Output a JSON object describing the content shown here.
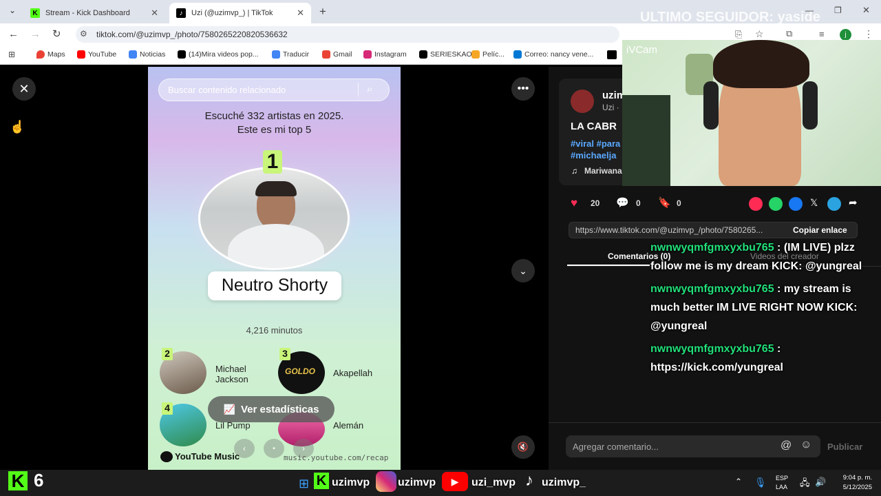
{
  "tabs": [
    {
      "title": "Stream - Kick Dashboard"
    },
    {
      "title": "Uzi (@uzimvp_) | TikTok"
    }
  ],
  "overlay_follower": "ULTIMO SEGUIDOR: yaside",
  "address": {
    "url": "tiktok.com/@uzimvp_/photo/7580265220820536632"
  },
  "bookmarks": [
    "Maps",
    "YouTube",
    "Noticias",
    "(14)Mira videos pop...",
    "Traducir",
    "Gmail",
    "Instagram",
    "SERIESKAO",
    "Pelíc...",
    "Correo: nancy vene..."
  ],
  "photo": {
    "search_placeholder": "Buscar contenido relacionado",
    "headline1": "Escuché 332 artistas en 2025.",
    "headline2": "Este es mi top 5",
    "rank1": "1",
    "top_artist": "Neutro Shorty",
    "minutes": "4,216 minutos",
    "artists": [
      {
        "rank": "2",
        "name1": "Michael",
        "name2": "Jackson"
      },
      {
        "rank": "3",
        "name1": "Akapellah",
        "name2": ""
      },
      {
        "rank": "4",
        "name1": "Lil Pump",
        "name2": ""
      },
      {
        "rank": "",
        "name1": "Alemán",
        "name2": ""
      }
    ],
    "stats_button": "Ver estadísticas",
    "footer_brand": "YouTube Music",
    "footer_url": "music.youtube.com/recap"
  },
  "post": {
    "author_handle": "uzim",
    "author_sub": "Uzi ·",
    "caption": "LA CABR",
    "tags1": "#viral #para",
    "tags2": "#michaelja",
    "music": "Mariwana",
    "likes": "20",
    "comments": "0",
    "saves": "0",
    "link_url": "https://www.tiktok.com/@uzimvp_/photo/7580265...",
    "copy_link": "Copiar enlace",
    "tab_comments": "Comentarios (0)",
    "tab_creator": "Videos del creador",
    "comment_placeholder": "Agregar comentario...",
    "publish": "Publicar"
  },
  "cam": {
    "label": "iVCam"
  },
  "chat": [
    {
      "user": "nwnwyqmfgmxyxbu765",
      "line1": " : (IM LIVE) plzz",
      "line2": "follow me is my dream KICK: @yungreal",
      "line3": ""
    },
    {
      "user": "nwnwyqmfgmxyxbu765",
      "line1": " : my stream is",
      "line2": "much better IM LIVE RIGHT NOW KICK:",
      "line3": "@yungreal"
    },
    {
      "user": "nwnwyqmfgmxyxbu765",
      "line1": " :",
      "line2": "https://kick.com/yungreal",
      "line3": ""
    }
  ],
  "taskbar": {
    "kick_count": "6",
    "labels": [
      "uzimvp",
      "uzimvp",
      "uzi_mvp",
      "uzimvp_"
    ],
    "lang1": "ESP",
    "lang2": "LAA",
    "time": "9:04 p. m.",
    "date": "5/12/2025"
  },
  "colors": {
    "kick_green": "#53fc18",
    "chat_green": "#22e07a",
    "tiktok_red": "#fe2c55"
  }
}
